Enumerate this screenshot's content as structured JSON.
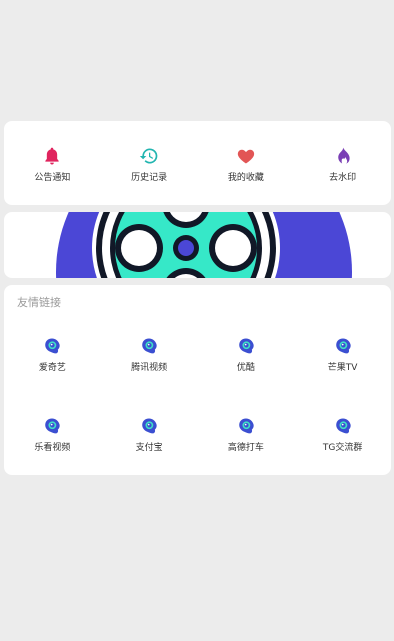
{
  "quick_actions": [
    {
      "label": "公告通知",
      "icon": "bell-icon",
      "color": "#e0245e"
    },
    {
      "label": "历史记录",
      "icon": "history-icon",
      "color": "#22b5b0"
    },
    {
      "label": "我的收藏",
      "icon": "heart-icon",
      "color": "#e25555"
    },
    {
      "label": "去水印",
      "icon": "flame-icon",
      "color": "#7a3fb5"
    }
  ],
  "banner": {
    "image": "film-reel-banner",
    "colors": {
      "reel": "#36e8c8",
      "outline": "#111827",
      "backdrop": "#4b47d6"
    }
  },
  "links": {
    "title": "友情链接",
    "items": [
      {
        "label": "爱奇艺"
      },
      {
        "label": "腾讯视频"
      },
      {
        "label": "优酷"
      },
      {
        "label": "芒果TV"
      },
      {
        "label": "乐看视频"
      },
      {
        "label": "支付宝"
      },
      {
        "label": "高德打车"
      },
      {
        "label": "TG交流群"
      }
    ],
    "icon": "link-logo-icon",
    "icon_colors": {
      "primary": "#3b4fd1",
      "accent": "#3fe0c5"
    }
  }
}
